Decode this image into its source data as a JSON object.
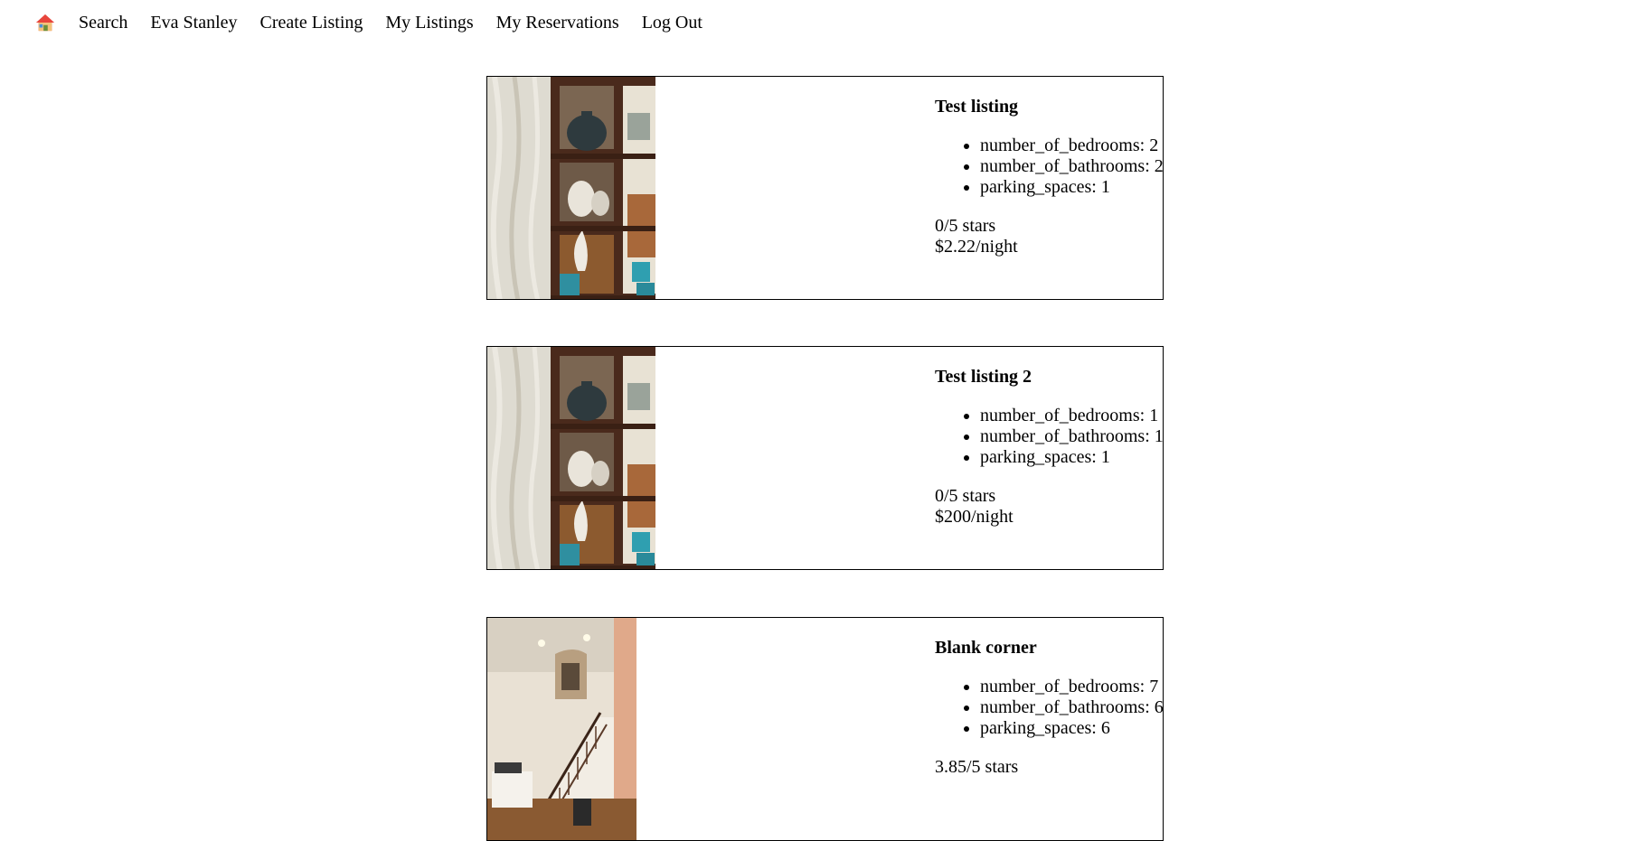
{
  "nav": {
    "home_icon": "house-emoji-icon",
    "links": [
      "Search",
      "Eva Stanley",
      "Create Listing",
      "My Listings",
      "My Reservations",
      "Log Out"
    ]
  },
  "listings": [
    {
      "title": "Test listing",
      "features": [
        "number_of_bedrooms: 2",
        "number_of_bathrooms: 2",
        "parking_spaces: 1"
      ],
      "rating": "0/5 stars",
      "price": "$2.22/night",
      "image": "interior-shelves-photo"
    },
    {
      "title": "Test listing 2",
      "features": [
        "number_of_bedrooms: 1",
        "number_of_bathrooms: 1",
        "parking_spaces: 1"
      ],
      "rating": "0/5 stars",
      "price": "$200/night",
      "image": "interior-shelves-photo"
    },
    {
      "title": "Blank corner",
      "features": [
        "number_of_bedrooms: 7",
        "number_of_bathrooms: 6",
        "parking_spaces: 6"
      ],
      "rating": "3.85/5 stars",
      "price": "",
      "image": "staircase-foyer-photo"
    }
  ],
  "colors": {
    "border": "#000000",
    "background": "#ffffff"
  }
}
